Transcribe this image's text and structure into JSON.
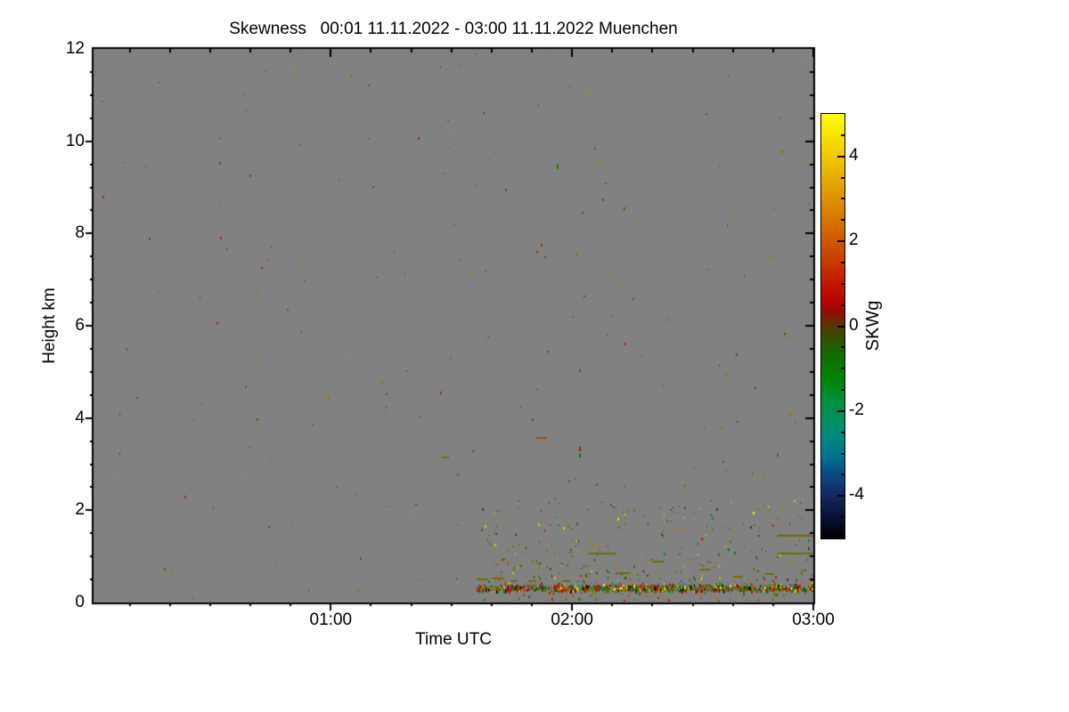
{
  "chart_data": {
    "type": "heatmap",
    "title": "Skewness   00:01 11.11.2022 - 03:00 11.11.2022 Muenchen",
    "xlabel": "Time UTC",
    "ylabel": "Height km",
    "colorbar_label": "SKWg",
    "x_domain": {
      "start_label": "00:01",
      "end_label": "03:00",
      "minutes": [
        1,
        180
      ]
    },
    "x_major_ticks": [
      {
        "minute": 60,
        "label": "01:00"
      },
      {
        "minute": 120,
        "label": "02:00"
      },
      {
        "minute": 180,
        "label": "03:00"
      }
    ],
    "x_minor_step_minutes": 10,
    "ylim_km": [
      0,
      12
    ],
    "y_major_ticks": [
      0,
      2,
      4,
      6,
      8,
      10,
      12
    ],
    "y_minor_step_km": 0.5,
    "zlim": [
      -5,
      5
    ],
    "colorbar_major_ticks": [
      4,
      2,
      0,
      -2,
      -4
    ],
    "colorbar_minor_step": 0.5,
    "grid": false,
    "legend_position": "right-colorbar",
    "colors": {
      "page_background": "#ffffff",
      "plot_background": "#818181",
      "frame": "#000000",
      "text": "#000000"
    },
    "colormap_stops": [
      {
        "v": 5.0,
        "c": "#FFFF00"
      },
      {
        "v": 4.5,
        "c": "#F8E300"
      },
      {
        "v": 4.0,
        "c": "#F0C800"
      },
      {
        "v": 3.5,
        "c": "#E8AC00"
      },
      {
        "v": 3.0,
        "c": "#E09000"
      },
      {
        "v": 2.5,
        "c": "#D87400"
      },
      {
        "v": 2.0,
        "c": "#D05800"
      },
      {
        "v": 1.5,
        "c": "#C83A00"
      },
      {
        "v": 1.0,
        "c": "#C01800"
      },
      {
        "v": 0.6,
        "c": "#B80400"
      },
      {
        "v": 0.3,
        "c": "#8C1000"
      },
      {
        "v": 0.0,
        "c": "#553800"
      },
      {
        "v": -0.3,
        "c": "#2F5200"
      },
      {
        "v": -0.7,
        "c": "#0E6E00"
      },
      {
        "v": -1.2,
        "c": "#008200"
      },
      {
        "v": -1.7,
        "c": "#008D38"
      },
      {
        "v": -2.2,
        "c": "#009060"
      },
      {
        "v": -2.6,
        "c": "#008880"
      },
      {
        "v": -3.1,
        "c": "#006F8E"
      },
      {
        "v": -3.5,
        "c": "#0C4884"
      },
      {
        "v": -4.0,
        "c": "#14265E"
      },
      {
        "v": -4.5,
        "c": "#0A1034"
      },
      {
        "v": -5.0,
        "c": "#000000"
      }
    ],
    "seed": 42,
    "noise_layers": [
      {
        "name": "background-speckle",
        "count": 290,
        "t": [
          1.5,
          179.5
        ],
        "km": [
          0.05,
          11.95
        ],
        "bias": 1,
        "palette": [
          "#7A7A00",
          "#5E5E00",
          "#B06800",
          "#257800",
          "#A83000",
          "#8A8A20",
          "#C07818"
        ]
      },
      {
        "name": "boundary-layer-cloud",
        "count": 330,
        "t": [
          97,
          179.8
        ],
        "km": [
          0.42,
          2.25
        ],
        "bias": 1.7,
        "palette": [
          "#6E6E00",
          "#6E6E00",
          "#117800",
          "#B42000",
          "#C07000",
          "#D8C800",
          "#404000",
          "#00807A"
        ]
      },
      {
        "name": "sub-band-dots",
        "count": 60,
        "t": [
          97,
          179.8
        ],
        "km": [
          0.05,
          0.24
        ],
        "bias": 1,
        "palette": [
          "#6E6E00",
          "#B42000",
          "#117800",
          "#C07000"
        ]
      }
    ],
    "band": {
      "name": "surface-signal-band",
      "t": [
        96.2,
        179.9
      ],
      "km": [
        0.27,
        0.4
      ],
      "density": 2.4,
      "palette": [
        "#BE1800",
        "#BE1800",
        "#BE1800",
        "#7A1400",
        "#7A1400",
        "#0B7800",
        "#0B7800",
        "#0B7800",
        "#6E6E00",
        "#6E6E00",
        "#C85A00",
        "#E8D800",
        "#141400",
        "#007A70"
      ]
    },
    "hlines": [
      {
        "t": [
          171.0,
          179.9
        ],
        "km": 1.44,
        "c": "#6E6E00"
      },
      {
        "t": [
          171.2,
          179.8
        ],
        "km": 1.07,
        "c": "#6E6E00"
      },
      {
        "t": [
          124.0,
          130.8
        ],
        "km": 1.07,
        "c": "#6E6E00"
      },
      {
        "t": [
          96.3,
          99.2
        ],
        "km": 0.5,
        "c": "#6E6E00"
      },
      {
        "t": [
          100.0,
          103.2
        ],
        "km": 0.52,
        "c": "#6E6E00"
      },
      {
        "t": [
          104.6,
          106.4
        ],
        "km": 0.47,
        "c": "#6E6E00"
      },
      {
        "t": [
          109.0,
          111.0
        ],
        "km": 0.47,
        "c": "#6E6E00"
      },
      {
        "t": [
          117.5,
          119.5
        ],
        "km": 0.46,
        "c": "#6E6E00"
      },
      {
        "t": [
          131.0,
          134.5
        ],
        "km": 0.63,
        "c": "#6E6E00"
      },
      {
        "t": [
          139.8,
          142.6
        ],
        "km": 0.88,
        "c": "#6E6E00"
      },
      {
        "t": [
          151.6,
          154.4
        ],
        "km": 0.72,
        "c": "#6E6E00"
      },
      {
        "t": [
          160.0,
          162.4
        ],
        "km": 0.55,
        "c": "#6E6E00"
      },
      {
        "t": [
          168.0,
          170.2
        ],
        "km": 0.62,
        "c": "#6E6E00"
      },
      {
        "t": [
          111.0,
          113.6
        ],
        "km": 3.57,
        "c": "#A85000"
      },
      {
        "t": [
          87.6,
          89.3
        ],
        "km": 3.15,
        "c": "#8A6A00"
      }
    ],
    "dots": [
      {
        "t": 122.0,
        "km": 3.32,
        "c": "#B41400",
        "w": 2,
        "h": 5
      },
      {
        "t": 122.0,
        "km": 3.18,
        "c": "#0B7800",
        "w": 2,
        "h": 4
      },
      {
        "t": 165.2,
        "km": 1.93,
        "c": "#F2E200",
        "w": 2,
        "h": 3
      },
      {
        "t": 131.5,
        "km": 1.8,
        "c": "#F0DC00",
        "w": 2,
        "h": 3
      },
      {
        "t": 118.0,
        "km": 1.62,
        "c": "#E8D000",
        "w": 2,
        "h": 3
      }
    ]
  }
}
